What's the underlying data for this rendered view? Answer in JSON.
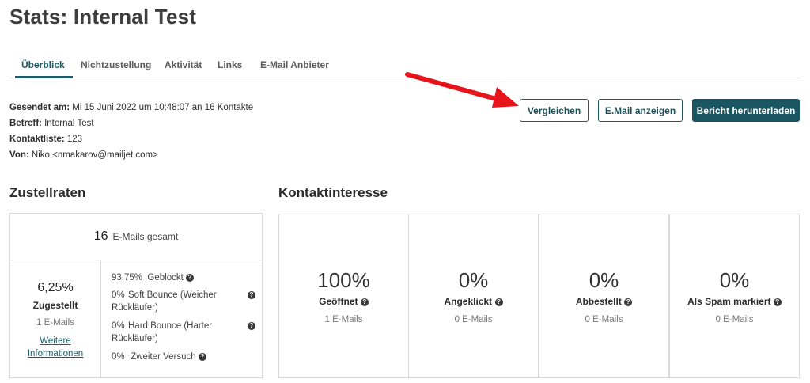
{
  "page": {
    "title": "Stats: Internal Test"
  },
  "tabs": [
    {
      "label": "Überblick",
      "active": true
    },
    {
      "label": "Nichtzustellung",
      "active": false
    },
    {
      "label": "Aktivität",
      "active": false
    },
    {
      "label": "Links",
      "active": false
    },
    {
      "label": "E-Mail Anbieter",
      "active": false
    }
  ],
  "meta": {
    "sent_label": "Gesendet am:",
    "sent_value": "Mi 15 Juni 2022 um 10:48:07 an 16 Kontakte",
    "subject_label": "Betreff:",
    "subject_value": "Internal Test",
    "list_label": "Kontaktliste:",
    "list_value": "123",
    "from_label": "Von:",
    "from_value": "Niko <nmakarov@mailjet.com>"
  },
  "actions": {
    "compare": "Vergleichen",
    "view_email": "E.Mail anzeigen",
    "download_report": "Bericht herunterladen"
  },
  "delivery": {
    "section_title": "Zustellraten",
    "total_count": "16",
    "total_label": "E-Mails gesamt",
    "delivered_pct": "6,25%",
    "delivered_label": "Zugestellt",
    "delivered_count": "1 E-Mails",
    "more_info_line1": "Weitere",
    "more_info_line2": "Informationen",
    "breakdown": [
      {
        "pct": "93,75%",
        "label": "Geblockt",
        "label2": ""
      },
      {
        "pct": "0%",
        "label": "Soft Bounce (Weicher",
        "label2": "Rückläufer)"
      },
      {
        "pct": "0%",
        "label": "Hard Bounce (Harter",
        "label2": "Rückläufer)"
      },
      {
        "pct": "0%",
        "label": "Zweiter Versuch",
        "label2": ""
      }
    ]
  },
  "interest": {
    "section_title": "Kontaktinteresse",
    "cards": [
      {
        "value": "100%",
        "label": "Geöffnet",
        "count": "1 E-Mails"
      },
      {
        "value": "0%",
        "label": "Angeklickt",
        "count": "0 E-Mails"
      },
      {
        "value": "0%",
        "label": "Abbestellt",
        "count": "0 E-Mails"
      },
      {
        "value": "0%",
        "label": "Als Spam markiert",
        "count": "0 E-Mails"
      }
    ]
  },
  "icons": {
    "help": "?",
    "arrow_color": "#e8141b"
  },
  "colors": {
    "accent": "#1e5c66",
    "primary_button": "#1a5561"
  }
}
